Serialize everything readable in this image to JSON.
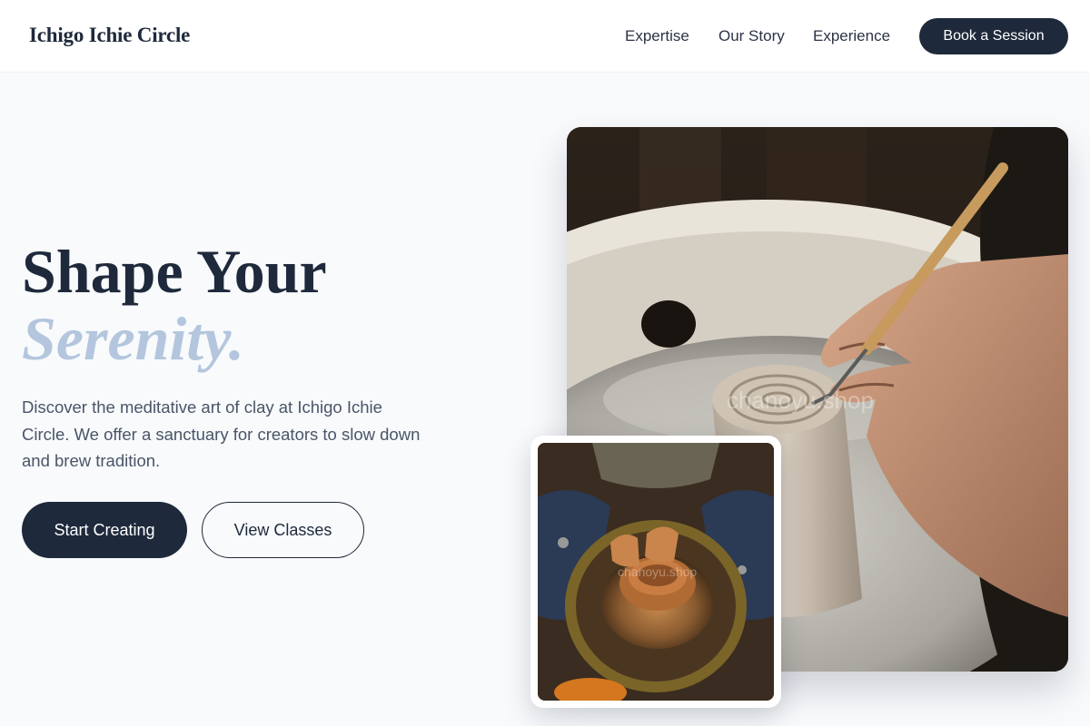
{
  "brand": {
    "name": "Ichigo Ichie Circle"
  },
  "nav": {
    "links": [
      "Expertise",
      "Our Story",
      "Experience"
    ],
    "cta": "Book a Session"
  },
  "hero": {
    "title_line1": "Shape Your",
    "title_line2": "Serenity.",
    "description": "Discover the meditative art of clay at Ichigo Ichie Circle. We offer a sanctuary for creators to slow down and brew tradition.",
    "primary_button": "Start Creating",
    "secondary_button": "View Classes"
  },
  "images": {
    "main_alt": "Hands trimming a clay pot on a pottery wheel",
    "small_alt": "Potter shaping clay on a wheel, viewed from above",
    "watermark": "chanoyu.shop"
  },
  "colors": {
    "primary": "#1e293b",
    "accent_italic": "#b4c6dd",
    "background": "#f8fafc"
  }
}
